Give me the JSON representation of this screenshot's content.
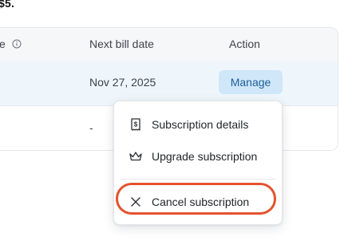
{
  "top_fragment": "$5.",
  "table": {
    "headers": {
      "type": "e",
      "next_bill_date": "Next bill date",
      "action": "Action"
    },
    "rows": [
      {
        "next_bill_date": "Nov 27, 2025",
        "action_label": "Manage"
      },
      {
        "next_bill_date": "-"
      }
    ]
  },
  "menu": {
    "items": [
      {
        "label": "Subscription details",
        "icon": "receipt-icon"
      },
      {
        "label": "Upgrade subscription",
        "icon": "crown-icon"
      },
      {
        "label": "Cancel subscription",
        "icon": "close-icon"
      }
    ]
  },
  "colors": {
    "row_highlight": "#eef6fc",
    "manage_bg": "#cfe7f8",
    "manage_text": "#1b5f9e",
    "highlight_ring": "#e4532e"
  }
}
